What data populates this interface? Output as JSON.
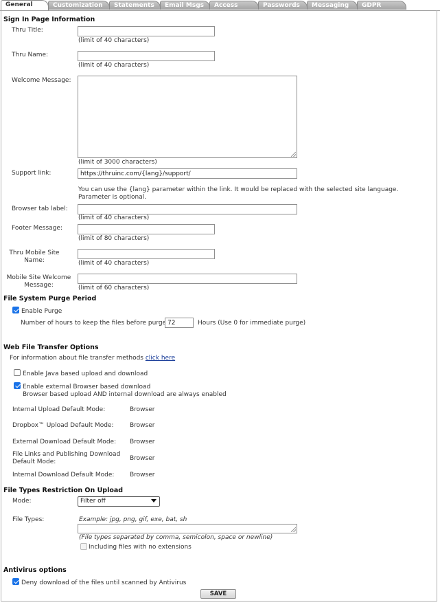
{
  "tabs": [
    "General",
    "Customization",
    "Statements",
    "Email Msgs",
    "Access",
    "Passwords",
    "Messaging",
    "GDPR"
  ],
  "sign_in": {
    "heading": "Sign In Page Information",
    "thru_title_label": "Thru Title:",
    "thru_title_hint": "(limit of 40 characters)",
    "thru_name_label": "Thru Name:",
    "thru_name_hint": "(limit of 40 characters)",
    "welcome_label": "Welcome Message:",
    "welcome_hint": "(limit of 3000 characters)",
    "support_label": "Support link:",
    "support_value": "https://thruinc.com/{lang}/support/",
    "support_note": "You can use the {lang} parameter within the link. It would be replaced with the selected site language. Parameter is optional.",
    "browser_tab_label": "Browser tab label:",
    "browser_tab_hint": "(limit of 40 characters)",
    "footer_label": "Footer Message:",
    "footer_hint": "(limit of 80 characters)",
    "mobile_name_label": "Thru Mobile Site Name:",
    "mobile_name_hint": "(limit of 40 characters)",
    "mobile_welcome_label": "Mobile Site Welcome Message:",
    "mobile_welcome_hint": "(limit of 60 characters)"
  },
  "purge": {
    "heading": "File System Purge Period",
    "enable_label": "Enable Purge",
    "enable_checked": true,
    "hours_label": "Number of hours to keep the files before purge:",
    "hours_value": "72",
    "hours_suffix": "Hours (Use 0 for immediate purge)"
  },
  "transfer": {
    "heading": "Web File Transfer Options",
    "info_text": "For information about file transfer methods",
    "info_link": "click here",
    "java_label": "Enable Java based upload and download",
    "java_checked": false,
    "external_label": "Enable external Browser based download",
    "external_checked": true,
    "external_note": "Browser based upload AND internal download are always enabled",
    "modes": [
      {
        "label": "Internal Upload Default Mode:",
        "value": "Browser"
      },
      {
        "label": "Dropbox™ Upload Default Mode:",
        "value": "Browser"
      },
      {
        "label": "External Download Default Mode:",
        "value": "Browser"
      },
      {
        "label": "File Links and Publishing Download Default Mode:",
        "value": "Browser"
      },
      {
        "label": "Internal Download Default Mode:",
        "value": "Browser"
      }
    ]
  },
  "restriction": {
    "heading": "File Types Restriction On Upload",
    "mode_label": "Mode:",
    "mode_value": "Filter off",
    "types_label": "File Types:",
    "example": "Example: jpg, png, gif, exe, bat, sh",
    "separator_note": "(File types separated by comma, semicolon, space or newline)",
    "no_ext_label": "Including files with no extensions"
  },
  "antivirus": {
    "heading": "Antivirus options",
    "deny_label": "Deny download of the files until scanned by Antivirus",
    "deny_checked": true
  },
  "save_label": "SAVE"
}
